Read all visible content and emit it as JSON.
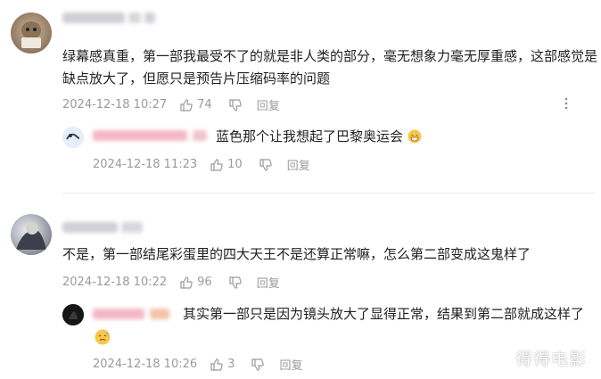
{
  "comments": [
    {
      "text": "绿幕感真重，第一部我最受不了的就是非人类的部分，毫无想象力毫无厚重感，这部感觉是缺点放大了，但愿只是预告片压缩码率的问题",
      "date": "2024-12-18 10:27",
      "likes": "74",
      "reply_label": "回复",
      "more_icon": "more-vertical-icon",
      "reply": {
        "text": "蓝色那个让我想起了巴黎奥运会",
        "emoji": "grin-emoji-icon",
        "date": "2024-12-18 11:23",
        "likes": "10",
        "reply_label": "回复"
      }
    },
    {
      "text": "不是，第一部结尾彩蛋里的四大天王不是还算正常嘛，怎么第二部变成这鬼样了",
      "date": "2024-12-18 10:22",
      "likes": "96",
      "reply_label": "回复",
      "reply": {
        "text": "其实第一部只是因为镜头放大了显得正常，结果到第二部就成这样了",
        "emoji": "sweat-emoji-icon",
        "date": "2024-12-18 10:26",
        "likes": "3",
        "reply_label": "回复"
      }
    }
  ],
  "watermark": "得得电影",
  "colors": {
    "meta_text": "#9a9a9a",
    "divider": "#ececec",
    "blur_pink": "#f3b7c8"
  }
}
